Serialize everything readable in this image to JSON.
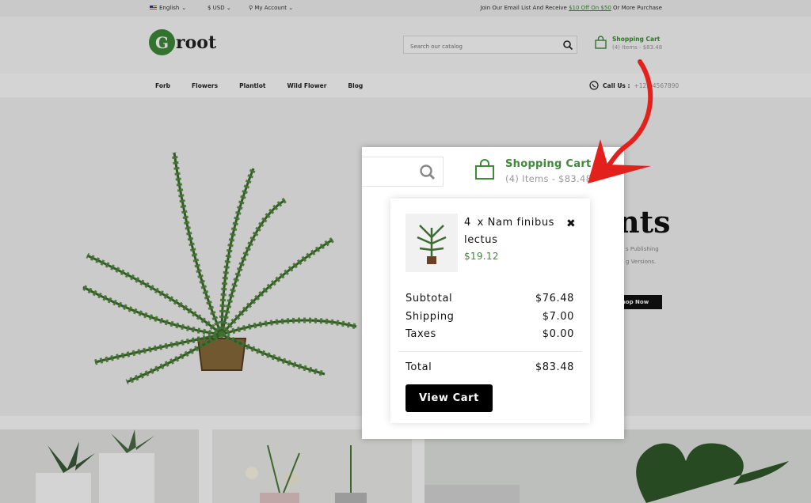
{
  "topbar": {
    "language": "English",
    "currency": "$ USD",
    "account": "My Account",
    "promo_prefix": "Join Our Email List And Receive",
    "promo_highlight": "$10 Off On $50",
    "promo_suffix": "Or More Purchase"
  },
  "header": {
    "logo_letter": "G",
    "logo_text": "root",
    "search_placeholder": "Search our catalog",
    "cart_title": "Shopping Cart",
    "cart_summary": "(4) Items - $83.48"
  },
  "nav": {
    "items": [
      "Forb",
      "Flowers",
      "Plantlot",
      "Wild Flower",
      "Blog"
    ],
    "call_label": "Call Us :",
    "call_number": "+123-4567890"
  },
  "hero": {
    "title": "nts",
    "desc_line1": "s Publishing",
    "desc_line2": "g Versions.",
    "button": "hop Now"
  },
  "zoom": {
    "cart_title": "Shopping Cart",
    "cart_summary": "(4) Items - $83.48"
  },
  "cart_dropdown": {
    "item_qty": "4 x",
    "item_name": "Nam finibus lectus",
    "item_price": "$19.12",
    "subtotal_label": "Subtotal",
    "subtotal_value": "$76.48",
    "shipping_label": "Shipping",
    "shipping_value": "$7.00",
    "taxes_label": "Taxes",
    "taxes_value": "$0.00",
    "total_label": "Total",
    "total_value": "$83.48",
    "view_cart": "View Cart"
  },
  "colors": {
    "accent": "#3d8b37",
    "annotation_arrow": "#e3201b"
  }
}
